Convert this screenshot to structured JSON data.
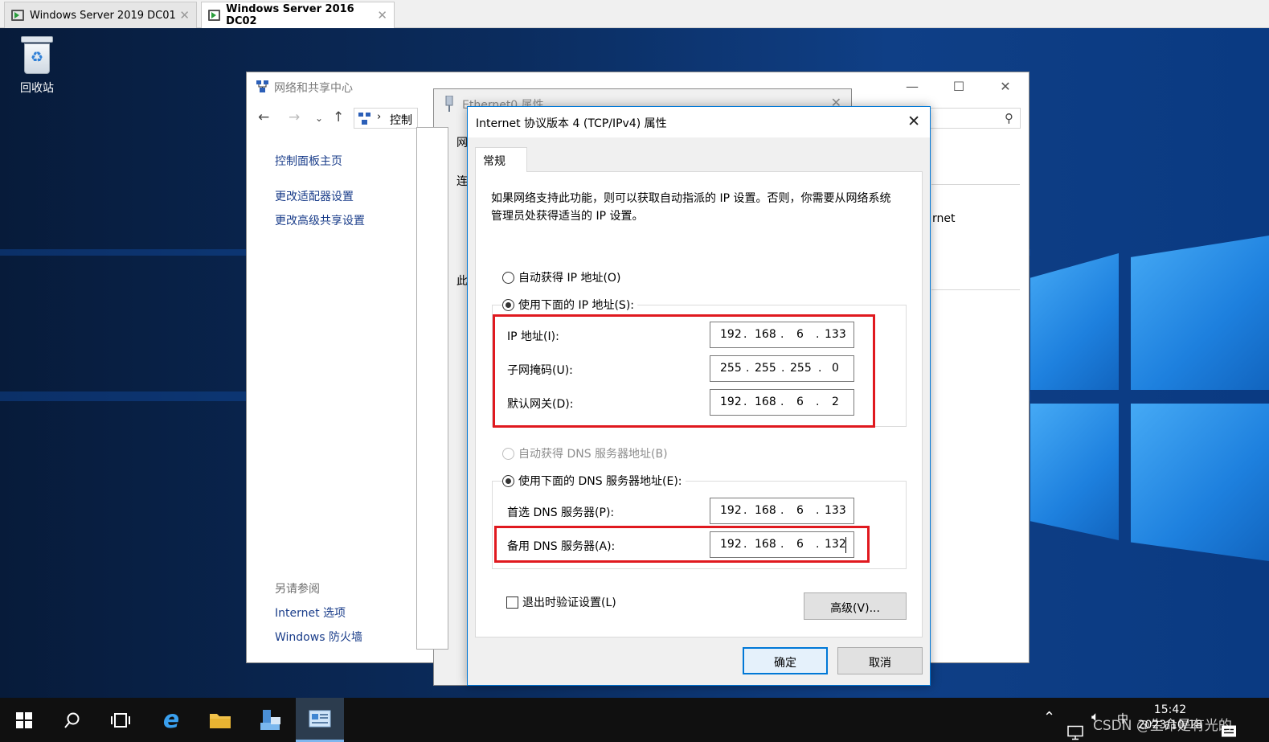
{
  "vm_tabs": [
    {
      "label": "Windows Server 2019 DC01",
      "active": false
    },
    {
      "label": "Windows Server 2016 DC02",
      "active": true
    }
  ],
  "desktop": {
    "recycle_bin_label": "回收站"
  },
  "nsc_window": {
    "title": "网络和共享中心",
    "address_text": "控制",
    "sidebar": {
      "home": "控制面板主页",
      "change_adapter": "更改适配器设置",
      "change_sharing": "更改高级共享设置",
      "see_also": "另请参阅",
      "internet_options": "Internet 选项",
      "firewall": "Windows 防火墙"
    },
    "partial_text": "rnet"
  },
  "ethernet_window": {
    "title": "Ethernet0 属性",
    "cut_labels": [
      "网络",
      "连",
      "此"
    ]
  },
  "tcp_dialog": {
    "title": "Internet 协议版本 4 (TCP/IPv4) 属性",
    "tab": "常规",
    "description": "如果网络支持此功能，则可以获取自动指派的 IP 设置。否则，你需要从网络系统管理员处获得适当的 IP 设置。",
    "auto_ip": "自动获得 IP 地址(O)",
    "manual_ip": "使用下面的 IP 地址(S):",
    "ip_label": "IP 地址(I):",
    "ip_value": [
      "192",
      "168",
      "6",
      "133"
    ],
    "mask_label": "子网掩码(U):",
    "mask_value": [
      "255",
      "255",
      "255",
      "0"
    ],
    "gateway_label": "默认网关(D):",
    "gateway_value": [
      "192",
      "168",
      "6",
      "2"
    ],
    "auto_dns": "自动获得 DNS 服务器地址(B)",
    "manual_dns": "使用下面的 DNS 服务器地址(E):",
    "preferred_dns_label": "首选 DNS 服务器(P):",
    "preferred_dns_value": [
      "192",
      "168",
      "6",
      "133"
    ],
    "alternate_dns_label": "备用 DNS 服务器(A):",
    "alternate_dns_value": [
      "192",
      "168",
      "6",
      "132"
    ],
    "validate_on_exit": "退出时验证设置(L)",
    "advanced_button": "高级(V)...",
    "ok_button": "确定",
    "cancel_button": "取消",
    "highlight_color": "#e0191f"
  },
  "taskbar": {
    "time": "15:42",
    "date": "2023/10/18",
    "watermark": "CSDN @生命是有光的"
  }
}
